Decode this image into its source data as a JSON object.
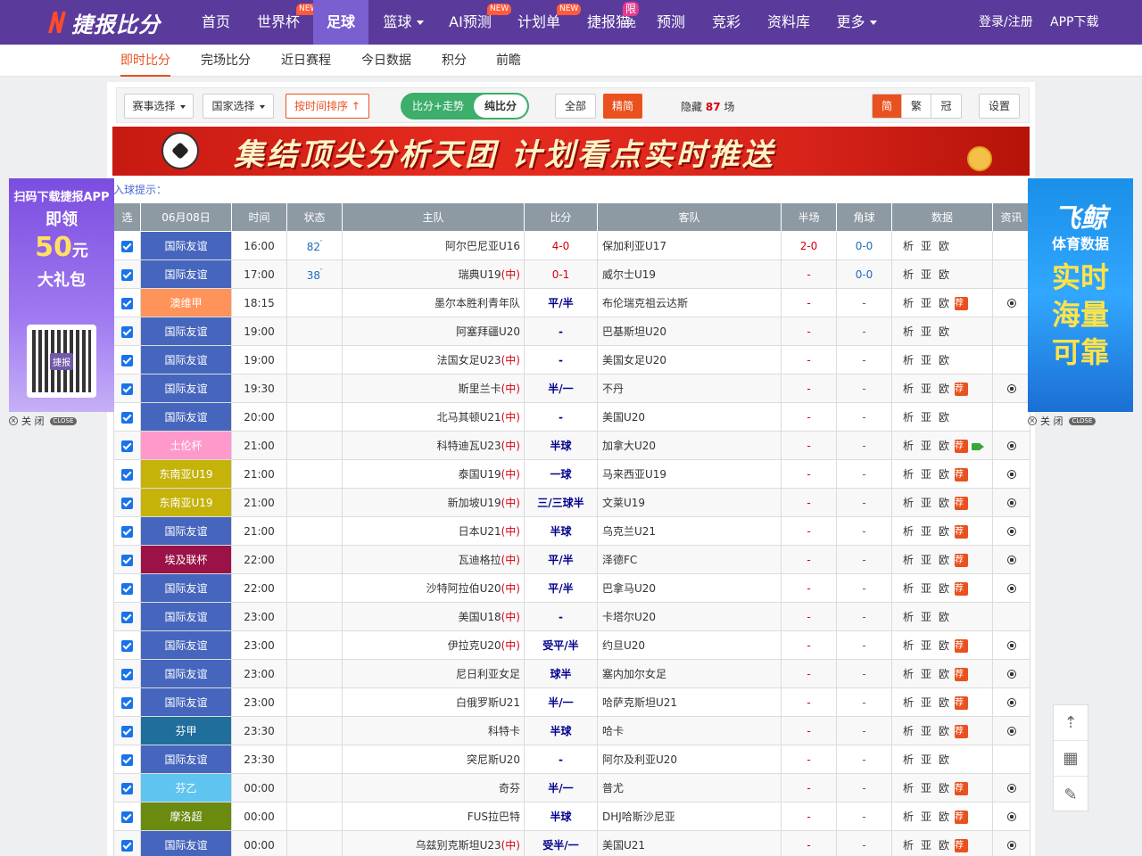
{
  "brand": {
    "name": "捷报比分"
  },
  "nav": {
    "items": [
      {
        "label": "首页",
        "badge": ""
      },
      {
        "label": "世界杯",
        "badge": "NEW"
      },
      {
        "label": "足球",
        "badge": ""
      },
      {
        "label": "篮球",
        "badge": ""
      },
      {
        "label": "AI预测",
        "badge": "NEW"
      },
      {
        "label": "计划单",
        "badge": "NEW"
      },
      {
        "label": "捷报猫",
        "badge": "限免"
      },
      {
        "label": "预测",
        "badge": ""
      },
      {
        "label": "竞彩",
        "badge": ""
      },
      {
        "label": "资料库",
        "badge": ""
      },
      {
        "label": "更多",
        "badge": ""
      }
    ],
    "login": "登录/注册",
    "app": "APP下载"
  },
  "subnav": [
    "即时比分",
    "完场比分",
    "近日赛程",
    "今日数据",
    "积分",
    "前瞻"
  ],
  "toolbar": {
    "event_select": "赛事选择",
    "country_select": "国家选择",
    "sort_time": "按时间排序",
    "toggle_left": "比分+走势",
    "toggle_right": "纯比分",
    "all": "全部",
    "featured": "精简",
    "hidden_prefix": "隐藏",
    "hidden_count": "87",
    "hidden_suffix": "场",
    "lang": [
      "简",
      "繁",
      "冠"
    ],
    "settings": "设置"
  },
  "banner": {
    "text": "集结顶尖分析天团  计划看点实时推送"
  },
  "goal_tip": "入球提示：",
  "table": {
    "headers": [
      "选",
      "06月08日",
      "时间",
      "状态",
      "主队",
      "比分",
      "客队",
      "半场",
      "角球",
      "数据",
      "资讯"
    ],
    "data_links": [
      "析",
      "亚",
      "欧"
    ],
    "rec_label": "荐",
    "rows": [
      {
        "league": "国际友谊",
        "color": "#4666bd",
        "time": "16:00",
        "status": "82",
        "home": "阿尔巴尼亚U16",
        "tag": "",
        "score": "4-0",
        "away": "保加利亚U17",
        "half": "2-0",
        "corner": "0-0",
        "rec": false,
        "video": false,
        "news": false
      },
      {
        "league": "国际友谊",
        "color": "#4666bd",
        "time": "17:00",
        "status": "38",
        "home": "瑞典U19",
        "tag": "(中)",
        "score": "0-1",
        "away": "威尔士U19",
        "half": "-",
        "corner": "0-0",
        "rec": false,
        "video": false,
        "news": false
      },
      {
        "league": "澳维甲",
        "color": "#ff935a",
        "time": "18:15",
        "status": "",
        "home": "墨尔本胜利青年队",
        "tag": "",
        "score": "平/半",
        "away": "布伦瑞克祖云达斯",
        "half": "-",
        "corner": "-",
        "rec": true,
        "video": false,
        "news": true
      },
      {
        "league": "国际友谊",
        "color": "#4666bd",
        "time": "19:00",
        "status": "",
        "home": "阿塞拜疆U20",
        "tag": "",
        "score": "-",
        "away": "巴基斯坦U20",
        "half": "-",
        "corner": "-",
        "rec": false,
        "video": false,
        "news": false
      },
      {
        "league": "国际友谊",
        "color": "#4666bd",
        "time": "19:00",
        "status": "",
        "home": "法国女足U23",
        "tag": "(中)",
        "score": "-",
        "away": "美国女足U20",
        "half": "-",
        "corner": "-",
        "rec": false,
        "video": false,
        "news": false
      },
      {
        "league": "国际友谊",
        "color": "#4666bd",
        "time": "19:30",
        "status": "",
        "home": "斯里兰卡",
        "tag": "(中)",
        "score": "半/一",
        "away": "不丹",
        "half": "-",
        "corner": "-",
        "rec": true,
        "video": false,
        "news": true
      },
      {
        "league": "国际友谊",
        "color": "#4666bd",
        "time": "20:00",
        "status": "",
        "home": "北马其顿U21",
        "tag": "(中)",
        "score": "-",
        "away": "美国U20",
        "half": "-",
        "corner": "-",
        "rec": false,
        "video": false,
        "news": false
      },
      {
        "league": "土伦杯",
        "color": "#ff99cc",
        "time": "21:00",
        "status": "",
        "home": "科特迪瓦U23",
        "tag": "(中)",
        "score": "半球",
        "away": "加拿大U20",
        "half": "-",
        "corner": "-",
        "rec": true,
        "video": true,
        "news": true
      },
      {
        "league": "东南亚U19",
        "color": "#c6b30a",
        "time": "21:00",
        "status": "",
        "home": "泰国U19",
        "tag": "(中)",
        "score": "一球",
        "away": "马来西亚U19",
        "half": "-",
        "corner": "-",
        "rec": true,
        "video": false,
        "news": true
      },
      {
        "league": "东南亚U19",
        "color": "#c6b30a",
        "time": "21:00",
        "status": "",
        "home": "新加坡U19",
        "tag": "(中)",
        "score": "三/三球半",
        "away": "文莱U19",
        "half": "-",
        "corner": "-",
        "rec": true,
        "video": false,
        "news": true
      },
      {
        "league": "国际友谊",
        "color": "#4666bd",
        "time": "21:00",
        "status": "",
        "home": "日本U21",
        "tag": "(中)",
        "score": "半球",
        "away": "乌克兰U21",
        "half": "-",
        "corner": "-",
        "rec": true,
        "video": false,
        "news": true
      },
      {
        "league": "埃及联杯",
        "color": "#9b1246",
        "time": "22:00",
        "status": "",
        "home": "瓦迪格拉",
        "tag": "(中)",
        "score": "平/半",
        "away": "泽德FC",
        "half": "-",
        "corner": "-",
        "rec": true,
        "video": false,
        "news": true
      },
      {
        "league": "国际友谊",
        "color": "#4666bd",
        "time": "22:00",
        "status": "",
        "home": "沙特阿拉伯U20",
        "tag": "(中)",
        "score": "平/半",
        "away": "巴拿马U20",
        "half": "-",
        "corner": "-",
        "rec": true,
        "video": false,
        "news": true
      },
      {
        "league": "国际友谊",
        "color": "#4666bd",
        "time": "23:00",
        "status": "",
        "home": "美国U18",
        "tag": "(中)",
        "score": "-",
        "away": "卡塔尔U20",
        "half": "-",
        "corner": "-",
        "rec": false,
        "video": false,
        "news": false
      },
      {
        "league": "国际友谊",
        "color": "#4666bd",
        "time": "23:00",
        "status": "",
        "home": "伊拉克U20",
        "tag": "(中)",
        "score": "受平/半",
        "away": "约旦U20",
        "half": "-",
        "corner": "-",
        "rec": true,
        "video": false,
        "news": true
      },
      {
        "league": "国际友谊",
        "color": "#4666bd",
        "time": "23:00",
        "status": "",
        "home": "尼日利亚女足",
        "tag": "",
        "score": "球半",
        "away": "塞内加尔女足",
        "half": "-",
        "corner": "-",
        "rec": true,
        "video": false,
        "news": true
      },
      {
        "league": "国际友谊",
        "color": "#4666bd",
        "time": "23:00",
        "status": "",
        "home": "白俄罗斯U21",
        "tag": "",
        "score": "半/一",
        "away": "哈萨克斯坦U21",
        "half": "-",
        "corner": "-",
        "rec": true,
        "video": false,
        "news": true
      },
      {
        "league": "芬甲",
        "color": "#1f6e9b",
        "time": "23:30",
        "status": "",
        "home": "科特卡",
        "tag": "",
        "score": "半球",
        "away": "哈卡",
        "half": "-",
        "corner": "-",
        "rec": true,
        "video": false,
        "news": true
      },
      {
        "league": "国际友谊",
        "color": "#4666bd",
        "time": "23:30",
        "status": "",
        "home": "突尼斯U20",
        "tag": "",
        "score": "-",
        "away": "阿尔及利亚U20",
        "half": "-",
        "corner": "-",
        "rec": false,
        "video": false,
        "news": false
      },
      {
        "league": "芬乙",
        "color": "#5fc5f0",
        "time": "00:00",
        "status": "",
        "home": "奇芬",
        "tag": "",
        "score": "半/一",
        "away": "普尤",
        "half": "-",
        "corner": "-",
        "rec": true,
        "video": false,
        "news": true
      },
      {
        "league": "摩洛超",
        "color": "#6a8a10",
        "time": "00:00",
        "status": "",
        "home": "FUS拉巴特",
        "tag": "",
        "score": "半球",
        "away": "DHJ哈斯沙尼亚",
        "half": "-",
        "corner": "-",
        "rec": true,
        "video": false,
        "news": true
      },
      {
        "league": "国际友谊",
        "color": "#4666bd",
        "time": "00:00",
        "status": "",
        "home": "乌兹别克斯坦U23",
        "tag": "(中)",
        "score": "受半/一",
        "away": "美国U21",
        "half": "-",
        "corner": "-",
        "rec": true,
        "video": false,
        "news": true
      }
    ]
  },
  "ad_left": {
    "line1": "扫码下载捷报APP",
    "line2": "即领",
    "line3": "50",
    "line3_unit": "元",
    "line4": "大礼包",
    "qr_label": "捷报"
  },
  "ad_right": {
    "line1": "飞鲸",
    "line2": "体育数据",
    "line3": "实时",
    "line4": "海量",
    "line5": "可靠"
  },
  "close": {
    "label": "关 闭",
    "badge": "CLOSE"
  },
  "colors": {
    "nav_bg": "#5a3b9b",
    "nav_active": "#7a5fd0",
    "accent": "#e9511e",
    "header_gray": "#8e9aa3",
    "toggle_green": "#3dae6b"
  }
}
